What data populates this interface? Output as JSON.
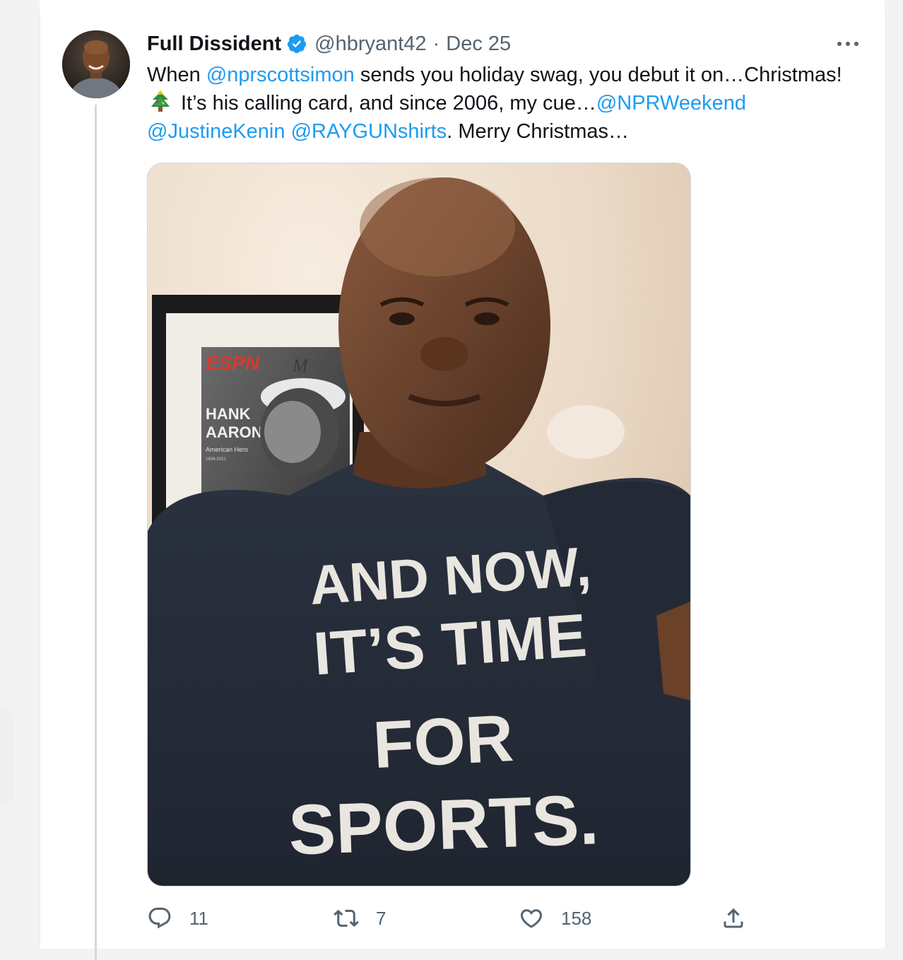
{
  "tweet": {
    "display_name": "Full Dissident",
    "handle": "@hbryant42",
    "separator": "·",
    "date": "Dec 25",
    "text": {
      "line1_pre": "When ",
      "line1_mention": "@nprscottsimon",
      "line1_post": " sends you holiday swag, you debut it on…Christmas!",
      "line2_pre": "It’s his calling card, and since 2006, my cue…",
      "line2_mention": "@NPRWeekend",
      "line3_mention1": "@JustineKenin",
      "line3_space": " ",
      "line3_mention2": "@RAYGUNshirts",
      "line3_post": ". Merry Christmas…"
    },
    "media": {
      "poster_brand": "ESPN",
      "poster_name_line1": "HANK",
      "poster_name_line2": "AARON",
      "poster_subtitle": "American Hero",
      "poster_years": "1934-2021",
      "cap_letter": "M",
      "shirt_line1": "AND NOW,",
      "shirt_line2": "IT’S TIME",
      "shirt_line3": "FOR",
      "shirt_line4": "SPORTS."
    },
    "actions": {
      "reply_count": "11",
      "retweet_count": "7",
      "like_count": "158"
    }
  },
  "icons": {
    "verified": "verified-badge-icon",
    "more": "more-dots-icon",
    "reply": "reply-icon",
    "retweet": "retweet-icon",
    "like": "heart-icon",
    "share": "share-icon",
    "tree": "christmas-tree-emoji"
  },
  "colors": {
    "link": "#1d9bf0",
    "secondary_text": "#536471",
    "primary_text": "#0f1419",
    "thread_line": "#cfd9de"
  }
}
